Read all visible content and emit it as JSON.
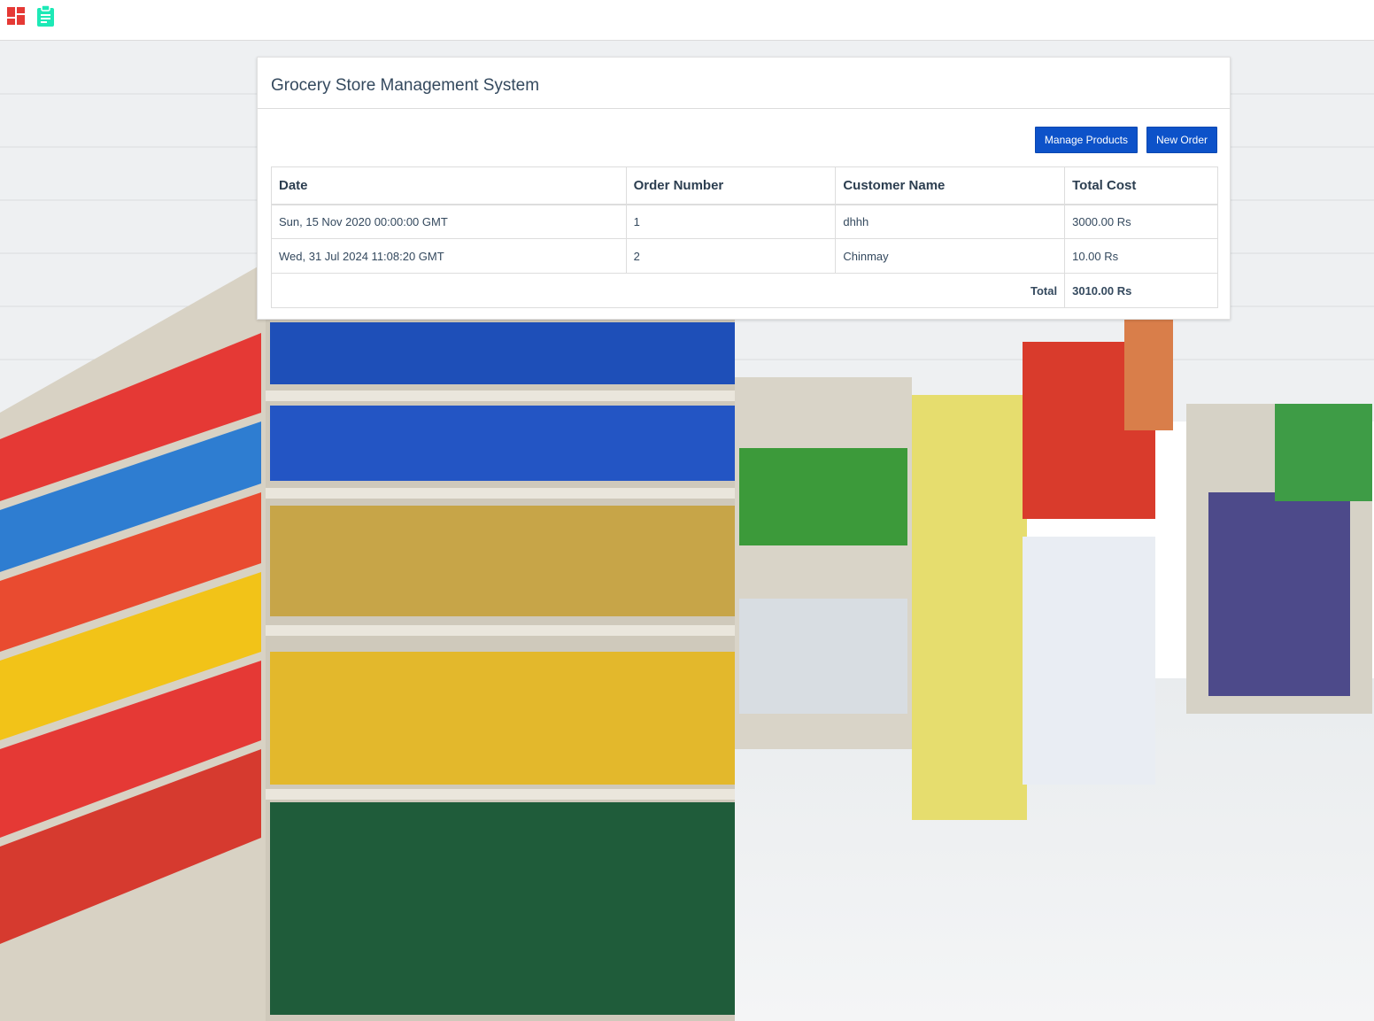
{
  "toolbar": {
    "icons": [
      "dashboard-icon",
      "clipboard-icon"
    ]
  },
  "panel": {
    "title": "Grocery Store Management System",
    "buttons": {
      "manage_products": "Manage Products",
      "new_order": "New Order"
    },
    "table": {
      "headers": [
        "Date",
        "Order Number",
        "Customer Name",
        "Total Cost"
      ],
      "rows": [
        {
          "date": "Sun, 15 Nov 2020 00:00:00 GMT",
          "order_number": "1",
          "customer_name": "dhhh",
          "total_cost": "3000.00 Rs"
        },
        {
          "date": "Wed, 31 Jul 2024 11:08:20 GMT",
          "order_number": "2",
          "customer_name": "Chinmay",
          "total_cost": "10.00 Rs"
        }
      ],
      "total_label": "Total",
      "total_value": "3010.00 Rs"
    }
  },
  "colors": {
    "primary_button": "#0d52c9",
    "dashboard_icon": "#e53935",
    "clipboard_icon": "#1de9b6"
  }
}
